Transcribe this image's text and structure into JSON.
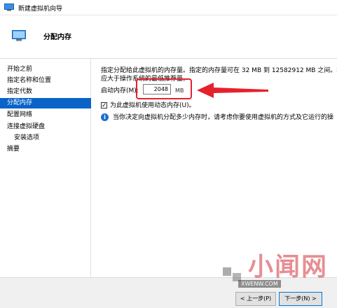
{
  "window": {
    "title": "新建虚拟机向导"
  },
  "header": {
    "title": "分配内存"
  },
  "nav": {
    "items": [
      {
        "label": "开始之前"
      },
      {
        "label": "指定名称和位置"
      },
      {
        "label": "指定代数"
      },
      {
        "label": "分配内存"
      },
      {
        "label": "配置网络"
      },
      {
        "label": "连接虚拟硬盘"
      },
      {
        "label": "安装选项"
      },
      {
        "label": "摘要"
      }
    ],
    "active_index": 3
  },
  "main": {
    "description_line1": "指定分配给此虚拟机的内存量。指定的内存量可在 32 MB 到 12582912 MB 之间。若要",
    "description_line2": "应大于操作系统的最低推荐量。",
    "startup_memory_label": "启动内存(M):",
    "startup_memory_value": "2048",
    "startup_memory_unit": "MB",
    "dynamic_memory_label": "为此虚拟机使用动态内存(U)。",
    "dynamic_memory_checked": true,
    "info_text": "当你决定向虚拟机分配多少内存时，请考虑你要使用虚拟机的方式及它运行的操"
  },
  "footer": {
    "prev_label": "< 上一步(P)",
    "next_label": "下一步(N) >"
  },
  "watermark": {
    "text": "小闻网",
    "url": "XWENW.COM"
  },
  "colors": {
    "accent": "#0a64c8",
    "highlight": "#e4222c"
  }
}
